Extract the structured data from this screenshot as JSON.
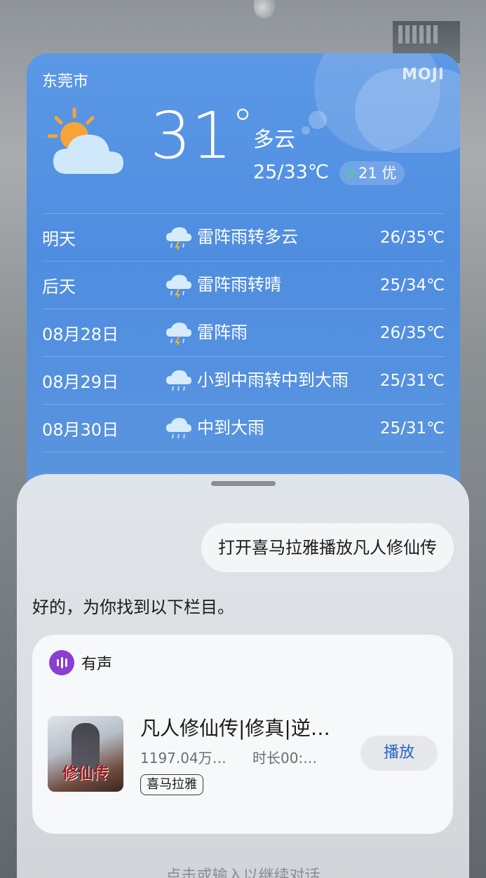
{
  "weather": {
    "city": "东莞市",
    "brand": "MOJI",
    "current_temp": "31",
    "degree_symbol": "°",
    "condition": "多云",
    "range": "25/33℃",
    "aqi_label": "21 优",
    "forecast": [
      {
        "day": "明天",
        "desc": "雷阵雨转多云",
        "temp": "26/35℃",
        "icon": "thunderstorm-icon"
      },
      {
        "day": "后天",
        "desc": "雷阵雨转晴",
        "temp": "25/34℃",
        "icon": "thunderstorm-icon"
      },
      {
        "day": "08月28日",
        "desc": "雷阵雨",
        "temp": "26/35℃",
        "icon": "thunderstorm-icon"
      },
      {
        "day": "08月29日",
        "desc": "小到中雨转中到大雨",
        "temp": "25/31℃",
        "icon": "rain-icon"
      },
      {
        "day": "08月30日",
        "desc": "中到大雨",
        "temp": "25/31℃",
        "icon": "rain-icon"
      }
    ]
  },
  "assistant": {
    "user_message": "打开喜马拉雅播放凡人修仙传",
    "reply": "好的，为你找到以下栏目。",
    "card": {
      "app_name": "有声",
      "item_title": "凡人修仙传|修真|逆…",
      "play_count": "1197.04万…",
      "duration": "时长00:…",
      "source_tag": "喜马拉雅",
      "play_label": "播放",
      "cover_title": "修仙传"
    },
    "hint": "点击或输入以继续对话"
  },
  "colors": {
    "card_blue": "#5b98e6",
    "accent_purple": "#8a3fd0",
    "play_blue": "#2a63c6",
    "aqi_green": "#4fd27a"
  }
}
